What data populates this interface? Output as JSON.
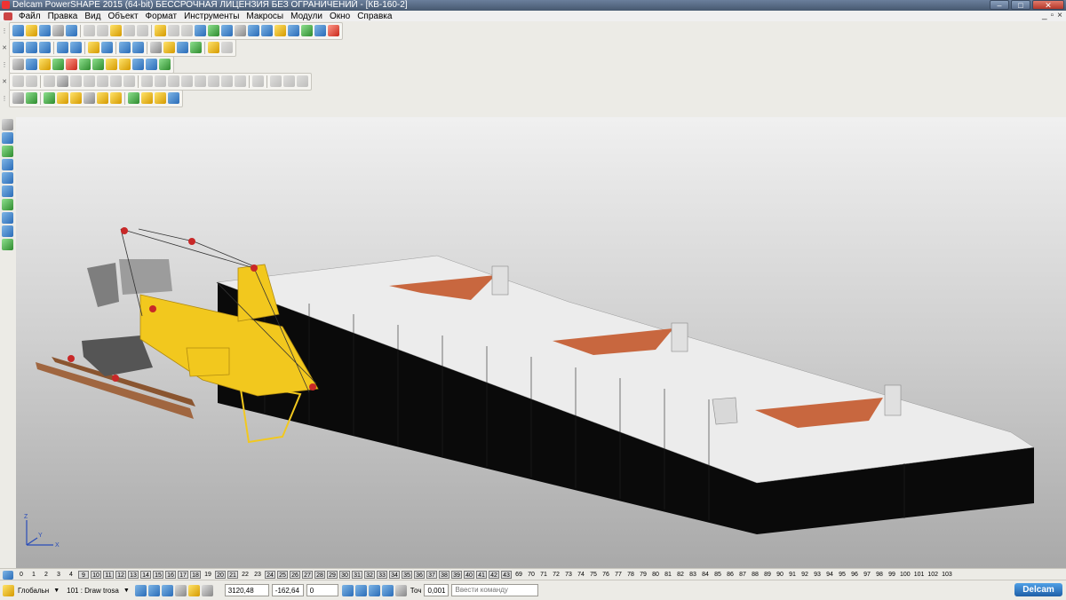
{
  "app": {
    "title": "Delcam PowerSHAPE 2015 (64-bit) БЕССРОЧНАЯ ЛИЦЕНЗИЯ БЕЗ ОГРАНИЧЕНИЙ - [КВ-160-2]"
  },
  "window_buttons": {
    "minimize": "–",
    "maximize": "□",
    "close": "✕"
  },
  "menu": [
    "Файл",
    "Правка",
    "Вид",
    "Объект",
    "Формат",
    "Инструменты",
    "Макросы",
    "Модули",
    "Окно",
    "Справка"
  ],
  "mdi_buttons": {
    "minimize": "_",
    "restore": "▫",
    "close": "×"
  },
  "statusbar": {
    "workplane": "Глобальн",
    "level": "101 : Draw trosa",
    "coord_x": "3120,48",
    "coord_y": "-162,64",
    "coord_z": "0",
    "tolerance_label": "Точ",
    "tolerance_value": "0,001",
    "command_placeholder": "Ввести команду",
    "logo": "Delcam"
  },
  "levels": {
    "items": [
      "0",
      "1",
      "2",
      "3",
      "4",
      "9",
      "10",
      "11",
      "12",
      "13",
      "14",
      "15",
      "16",
      "17",
      "18",
      "19",
      "20",
      "21",
      "22",
      "23",
      "24",
      "25",
      "26",
      "27",
      "28",
      "29",
      "30",
      "31",
      "32",
      "33",
      "34",
      "35",
      "36",
      "37",
      "38",
      "39",
      "40",
      "41",
      "42",
      "43",
      "69",
      "70",
      "71",
      "72",
      "73",
      "74",
      "75",
      "76",
      "77",
      "78",
      "79",
      "80",
      "81",
      "82",
      "83",
      "84",
      "85",
      "86",
      "87",
      "88",
      "89",
      "90",
      "91",
      "92",
      "93",
      "94",
      "95",
      "96",
      "97",
      "98",
      "99",
      "100",
      "101",
      "102",
      "103"
    ],
    "active": [
      "9",
      "10",
      "11",
      "12",
      "13",
      "14",
      "15",
      "16",
      "17",
      "18",
      "20",
      "21",
      "24",
      "25",
      "26",
      "27",
      "28",
      "29",
      "30",
      "31",
      "32",
      "33",
      "34",
      "35",
      "36",
      "37",
      "38",
      "39",
      "40",
      "41",
      "42",
      "43"
    ]
  },
  "axis_labels": {
    "x": "X",
    "y": "Y",
    "z": "Z"
  },
  "colors": {
    "crane_yellow": "#f2c81e",
    "deck_top": "#ececec",
    "hull_side": "#0a0a0a",
    "hatch_orange": "#c8673f"
  }
}
